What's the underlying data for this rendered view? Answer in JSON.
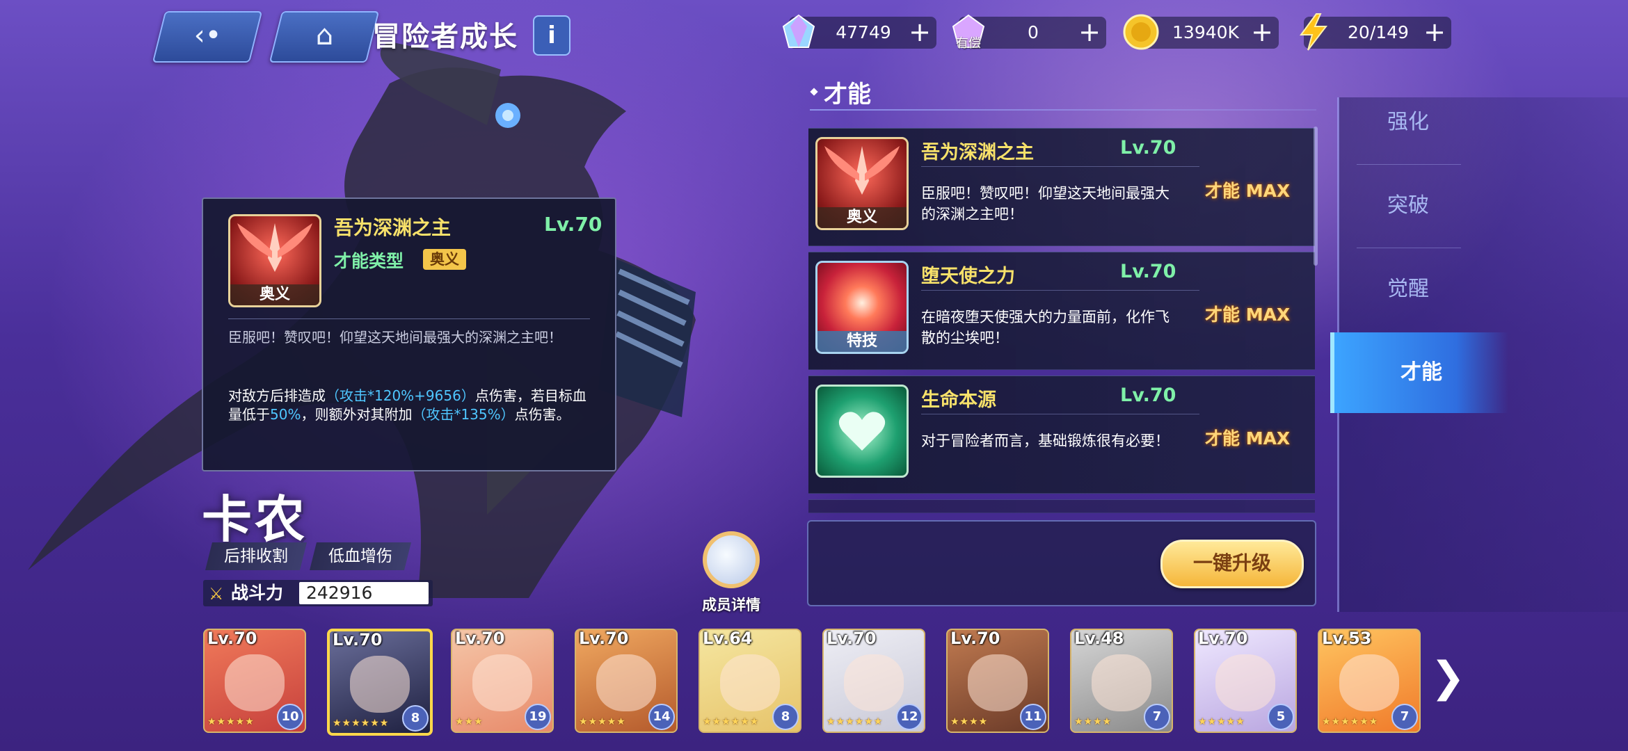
{
  "header": {
    "title": "冒险者成长",
    "info_label": "i"
  },
  "resources": [
    {
      "icon": "crystal-icon",
      "value": "47749",
      "label": ""
    },
    {
      "icon": "paid-crystal-icon",
      "value": "0",
      "label": "有偿"
    },
    {
      "icon": "gold-coin-icon",
      "value": "13940K",
      "label": ""
    },
    {
      "icon": "stamina-bolt-icon",
      "value": "20/149",
      "label": ""
    }
  ],
  "talent_section": {
    "title": "才能",
    "skills": [
      {
        "name": "吾为深渊之主",
        "level": "Lv.70",
        "type_tag": "奥义",
        "desc": "臣服吧！赞叹吧！仰望这天地间最强大的深渊之主吧！",
        "status": "才能 MAX",
        "theme": "red-wings"
      },
      {
        "name": "堕天使之力",
        "level": "Lv.70",
        "type_tag": "特技",
        "desc": "在暗夜堕天使强大的力量面前，化作飞散的尘埃吧！",
        "status": "才能 MAX",
        "theme": "red-orb"
      },
      {
        "name": "生命本源",
        "level": "Lv.70",
        "type_tag": "",
        "desc": "对于冒险者而言，基础锻炼很有必要！",
        "status": "才能 MAX",
        "theme": "green-heart"
      }
    ],
    "upgrade_button": "一键升级"
  },
  "side_tabs": [
    {
      "label": "强化",
      "active": false
    },
    {
      "label": "突破",
      "active": false
    },
    {
      "label": "觉醒",
      "active": false
    },
    {
      "label": "才能",
      "active": true
    }
  ],
  "tooltip": {
    "name": "吾为深渊之主",
    "level": "Lv.70",
    "type_label": "才能类型",
    "type_value": "奥义",
    "icon_tag": "奥义",
    "desc": "臣服吧！赞叹吧！仰望这天地间最强大的深渊之主吧！",
    "effect_parts": [
      "对敌方后排造成",
      "（攻击*120%+9656）",
      "点伤害，若目标血量低于",
      "50%",
      "，则额外对其附加",
      "（攻击*135%）",
      "点伤害。"
    ]
  },
  "character": {
    "name": "卡农",
    "tags": [
      "后排收割",
      "低血增伤"
    ],
    "power_label": "战斗力",
    "power_value": "242916",
    "member_detail_label": "成员详情"
  },
  "roster": [
    {
      "level": "Lv.70",
      "stars": "★★★★★",
      "badge": "10",
      "selected": false,
      "bg": "#c6403c",
      "bg2": "#f07a5a"
    },
    {
      "level": "Lv.70",
      "stars": "★★★★★★",
      "badge": "8",
      "selected": true,
      "bg": "#1e2040",
      "bg2": "#6a6e9a"
    },
    {
      "level": "Lv.70",
      "stars": "★★★",
      "badge": "19",
      "selected": false,
      "bg": "#e88a6a",
      "bg2": "#f5c6a8"
    },
    {
      "level": "Lv.70",
      "stars": "★★★★★",
      "badge": "14",
      "selected": false,
      "bg": "#b45a2c",
      "bg2": "#f0a860"
    },
    {
      "level": "Lv.64",
      "stars": "★★★★★★",
      "badge": "8",
      "selected": false,
      "bg": "#e6c36a",
      "bg2": "#f5e6a0"
    },
    {
      "level": "Lv.70",
      "stars": "★★★★★★",
      "badge": "12",
      "selected": false,
      "bg": "#c8c8d6",
      "bg2": "#eeeef5"
    },
    {
      "level": "Lv.70",
      "stars": "★★★★",
      "badge": "11",
      "selected": false,
      "bg": "#6a3a28",
      "bg2": "#c07a50"
    },
    {
      "level": "Lv.48",
      "stars": "★★★★",
      "badge": "7",
      "selected": false,
      "bg": "#8a8a8a",
      "bg2": "#d6d6d6"
    },
    {
      "level": "Lv.70",
      "stars": "★★★★★",
      "badge": "5",
      "selected": false,
      "bg": "#b9a6e0",
      "bg2": "#efe8ff"
    },
    {
      "level": "Lv.53",
      "stars": "★★★★★★",
      "badge": "7",
      "selected": false,
      "bg": "#f07a2a",
      "bg2": "#ffc460"
    }
  ]
}
